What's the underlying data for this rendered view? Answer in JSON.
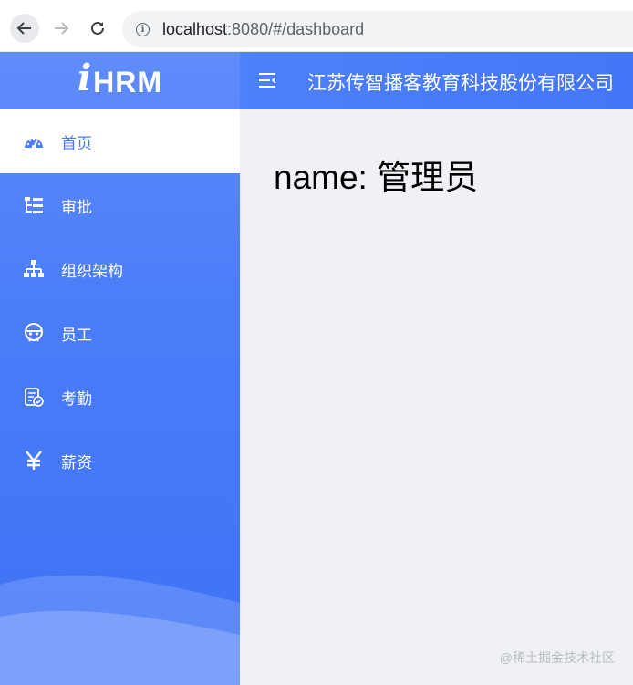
{
  "browser": {
    "url_host": "localhost",
    "url_rest": ":8080/#/dashboard"
  },
  "logo": {
    "i": "i",
    "text": "HRM"
  },
  "menu": [
    {
      "label": "首页",
      "icon": "dashboard-gauge-icon",
      "active": true
    },
    {
      "label": "审批",
      "icon": "approval-tree-icon",
      "active": false
    },
    {
      "label": "组织架构",
      "icon": "org-chart-icon",
      "active": false
    },
    {
      "label": "员工",
      "icon": "employee-icon",
      "active": false
    },
    {
      "label": "考勤",
      "icon": "attendance-clipboard-icon",
      "active": false
    },
    {
      "label": "薪资",
      "icon": "yen-icon",
      "active": false
    }
  ],
  "header": {
    "company": "江苏传智播客教育科技股份有限公司"
  },
  "main": {
    "greeting": "name: 管理员"
  },
  "watermark": "@稀土掘金技术社区",
  "colors": {
    "sidebar": "#4b7df8",
    "active_text": "#4a7cf7",
    "content_bg": "#eff1f5"
  }
}
